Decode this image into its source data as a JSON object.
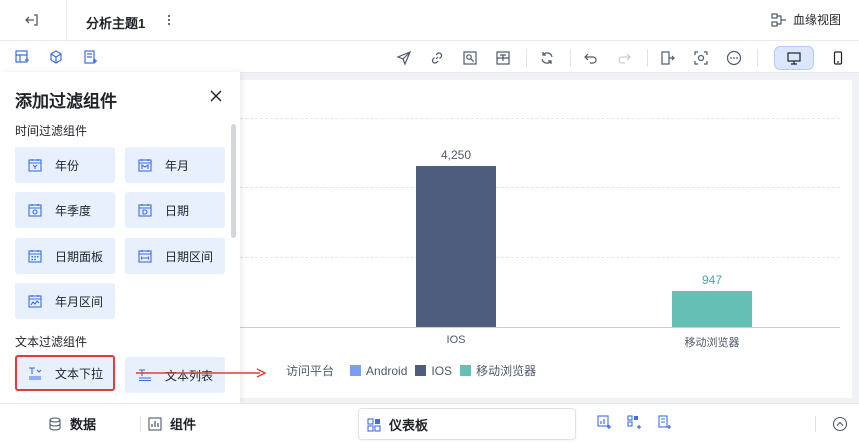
{
  "header": {
    "title": "分析主题1",
    "lineage_label": "血缘视图"
  },
  "panel": {
    "title": "添加过滤组件",
    "time_section": "时间过滤组件",
    "text_section": "文本过滤组件",
    "time_items": [
      "年份",
      "年月",
      "年季度",
      "日期",
      "日期面板",
      "日期区间",
      "年月区间"
    ],
    "text_items": [
      "文本下拉",
      "文本列表"
    ]
  },
  "chart_data": {
    "type": "bar",
    "categories": [
      "Android",
      "IOS",
      "移动浏览器"
    ],
    "visible_x_ticks": [
      "IOS",
      "移动浏览器"
    ],
    "series": [
      {
        "name": "Android",
        "values": [
          null,
          null,
          null
        ],
        "color": "#7b9ef0"
      },
      {
        "name": "IOS",
        "values": [
          null,
          4250,
          null
        ],
        "color": "#4e5d7e"
      },
      {
        "name": "移动浏览器",
        "values": [
          null,
          null,
          947
        ],
        "color": "#66bfb5"
      }
    ],
    "data_labels": {
      "ios": "4,250",
      "mobile": "947"
    },
    "legend_title": "访问平台",
    "ylim": [
      0,
      5500
    ],
    "grid": true,
    "legend_position": "bottom"
  },
  "bottombar": {
    "data_label": "数据",
    "component_label": "组件",
    "dashboard_label": "仪表板"
  },
  "colors": {
    "accent": "#3c6ee0",
    "highlight_border": "#e03c3c",
    "button_bg": "#e8effd"
  }
}
